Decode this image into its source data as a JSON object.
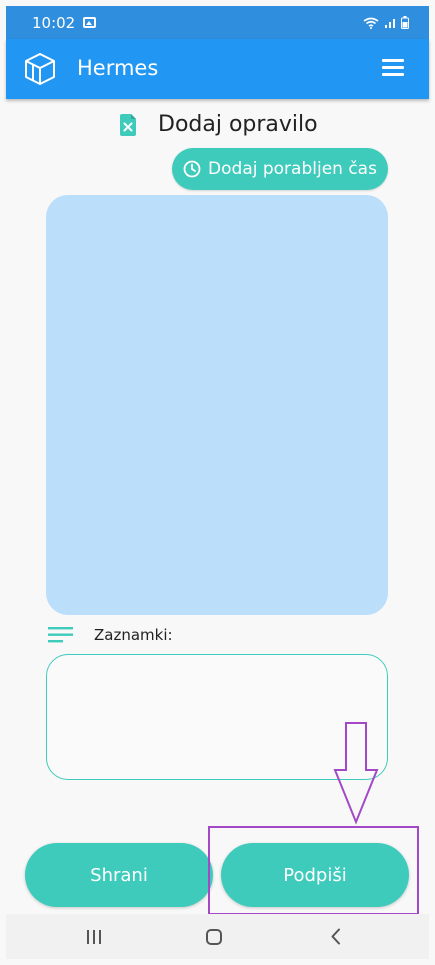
{
  "status_bar": {
    "time": "10:02"
  },
  "app_bar": {
    "title": "Hermes"
  },
  "page": {
    "title": "Dodaj opravilo",
    "add_time_label": "Dodaj porabljen čas",
    "notes_label": "Zaznamki:",
    "notes_value": ""
  },
  "actions": {
    "save_label": "Shrani",
    "sign_label": "Podpiši"
  },
  "colors": {
    "app_bar": "#2196f3",
    "status_bar": "#2f8fde",
    "accent": "#3ecbbb",
    "signature_pad": "#bbdefb",
    "annotation": "#a349c6"
  },
  "icons": {
    "status": [
      "gallery-icon",
      "wifi-icon",
      "signal-icon",
      "battery-icon"
    ],
    "app_bar": [
      "app-logo-icon",
      "hamburger-menu-icon"
    ],
    "page": [
      "document-tools-icon",
      "clock-icon",
      "notes-lines-icon"
    ],
    "nav": [
      "recent-apps-icon",
      "home-icon",
      "back-icon"
    ]
  }
}
